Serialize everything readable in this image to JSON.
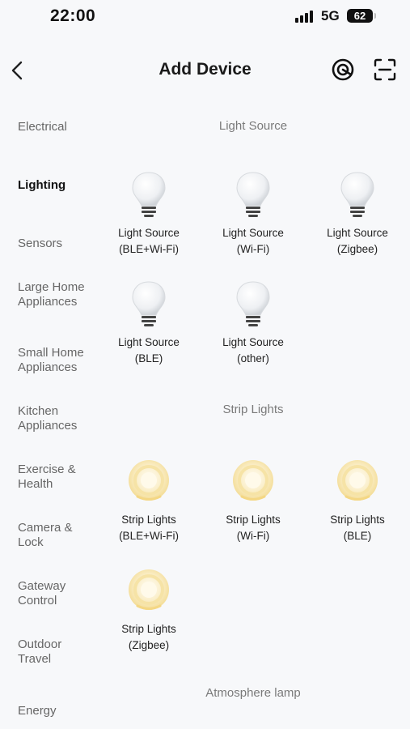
{
  "status": {
    "time": "22:00",
    "network": "5G",
    "battery": "62"
  },
  "header": {
    "title": "Add Device"
  },
  "sidebar": {
    "items": [
      {
        "label": "Electrical"
      },
      {
        "label": "Lighting"
      },
      {
        "label": "Sensors"
      },
      {
        "label": "Large Home Appliances"
      },
      {
        "label": "Small Home Appliances"
      },
      {
        "label": "Kitchen Appliances"
      },
      {
        "label": "Exercise & Health"
      },
      {
        "label": "Camera & Lock"
      },
      {
        "label": "Gateway Control"
      },
      {
        "label": "Outdoor Travel"
      },
      {
        "label": "Energy"
      }
    ],
    "active": "Lighting"
  },
  "sections": [
    {
      "title": "Light Source",
      "devices": [
        {
          "line1": "Light Source",
          "line2": "(BLE+Wi-Fi)",
          "icon": "light-bulb-icon"
        },
        {
          "line1": "Light Source",
          "line2": "(Wi-Fi)",
          "icon": "light-bulb-icon"
        },
        {
          "line1": "Light Source",
          "line2": "(Zigbee)",
          "icon": "light-bulb-icon"
        },
        {
          "line1": "Light Source",
          "line2": "(BLE)",
          "icon": "light-bulb-icon"
        },
        {
          "line1": "Light Source",
          "line2": "(other)",
          "icon": "light-bulb-icon"
        }
      ]
    },
    {
      "title": "Strip Lights",
      "devices": [
        {
          "line1": "Strip Lights",
          "line2": "(BLE+Wi-Fi)",
          "icon": "light-strip-icon"
        },
        {
          "line1": "Strip Lights",
          "line2": "(Wi-Fi)",
          "icon": "light-strip-icon"
        },
        {
          "line1": "Strip Lights",
          "line2": "(BLE)",
          "icon": "light-strip-icon"
        },
        {
          "line1": "Strip Lights",
          "line2": "(Zigbee)",
          "icon": "light-strip-icon"
        }
      ]
    },
    {
      "title": "Atmosphere lamp",
      "devices": []
    }
  ],
  "colors": {
    "background": "#f7f8fa",
    "strip_glow": "#f5d98a"
  }
}
